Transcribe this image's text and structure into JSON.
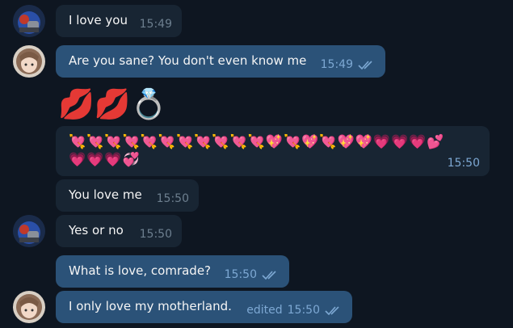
{
  "messages": [
    {
      "text": "I love you",
      "time": "15:49",
      "direction": "incoming"
    },
    {
      "text": "Are you sane? You don't even know me",
      "time": "15:49",
      "direction": "outgoing",
      "read": true
    },
    {
      "emojis": "💋💋💍",
      "direction": "outgoing"
    },
    {
      "line1": "💘💘💘💘💘💘💘💘💘💘💘💖💘💖💘💖💖💗💗💗💕",
      "line2": "💗💗💗💞",
      "time": "15:50",
      "direction": "outgoing"
    },
    {
      "text": "You love me",
      "time": "15:50",
      "direction": "incoming"
    },
    {
      "text": "Yes or no",
      "time": "15:50",
      "direction": "incoming"
    },
    {
      "text": "What is love, comrade?",
      "time": "15:50",
      "direction": "outgoing",
      "read": true
    },
    {
      "text": "I only love my motherland.",
      "time": "15:50",
      "edited_label": "edited",
      "direction": "outgoing",
      "read": true
    }
  ],
  "colors": {
    "background": "#0e1621",
    "incoming_bubble": "#182533",
    "outgoing_bubble": "#2b5278",
    "read_ticks": "#7da8d3"
  }
}
